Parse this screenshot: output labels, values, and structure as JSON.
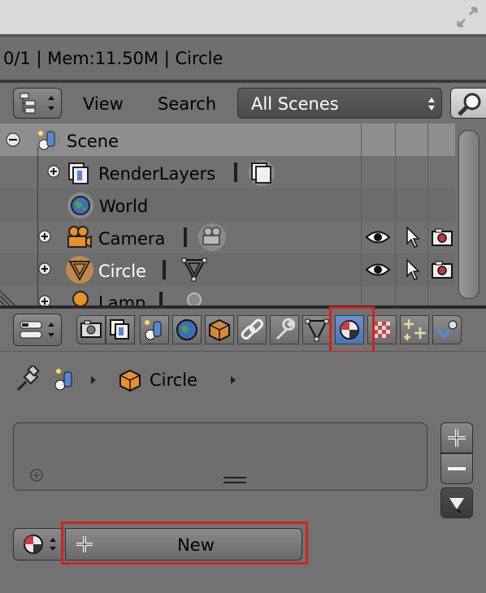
{
  "info_bar": {
    "text": "0/1 | Mem:11.50M | Circle"
  },
  "outliner_header": {
    "view_label": "View",
    "search_label": "Search",
    "scene_dropdown_value": "All Scenes"
  },
  "outliner": {
    "rows": [
      {
        "label": "Scene"
      },
      {
        "label": "RenderLayers"
      },
      {
        "label": "World"
      },
      {
        "label": "Camera"
      },
      {
        "label": "Circle"
      },
      {
        "label": "Lamp"
      }
    ]
  },
  "properties": {
    "breadcrumb_object": "Circle",
    "new_button_label": "New"
  },
  "colors": {
    "highlight_red": "#d32020",
    "selected_text": "#ffffff",
    "active_tab": "#5680c2"
  }
}
